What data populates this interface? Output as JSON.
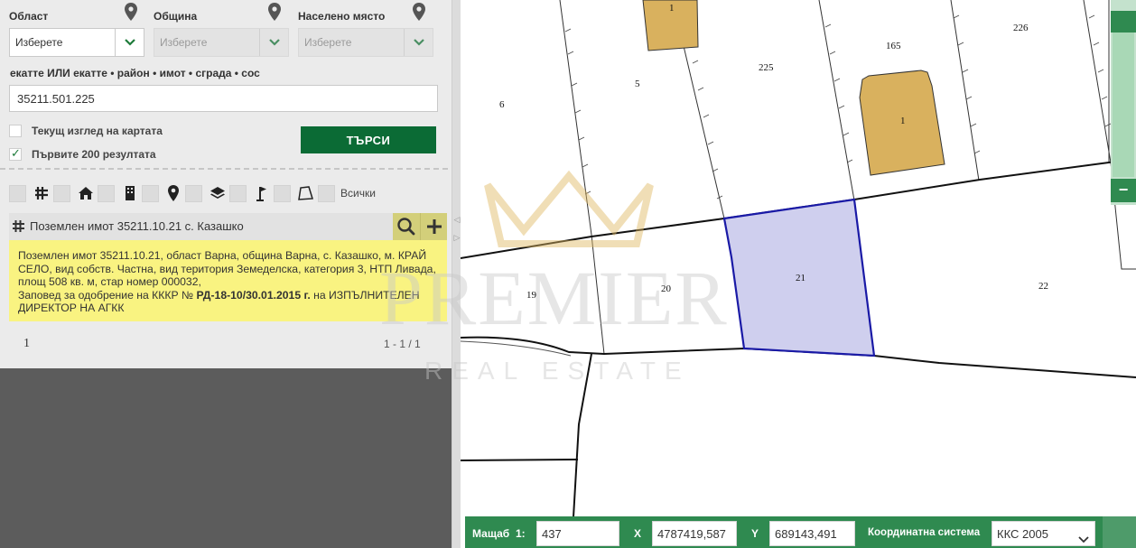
{
  "filters": {
    "region": {
      "label": "Област",
      "value": "Изберете"
    },
    "municipality": {
      "label": "Община",
      "value": "Изберете"
    },
    "settlement": {
      "label": "Населено място",
      "value": "Изберете"
    }
  },
  "search": {
    "label": "екатте ИЛИ екатте • район • имот • сграда • сос",
    "value": "35211.501.225",
    "current_view_label": "Текущ изглед на картата",
    "first200_label": "Първите 200 резултата",
    "button_label": "ТЪРСИ"
  },
  "toolbar": {
    "all_label": "Всички",
    "icons": [
      "parcel-grid-icon",
      "home-icon",
      "building-icon",
      "location-pin-icon",
      "layers-icon",
      "flag-icon",
      "polygon-icon"
    ]
  },
  "result": {
    "title": "Поземлен имот 35211.10.21 с. Казашко",
    "details_main": "Поземлен имот 35211.10.21, област Варна, община Варна, с. Казашко, м. КРАЙ СЕЛО, вид собств. Частна, вид територия Земеделска, категория 3, НТП Ливада, площ 508 кв. м, стар номер 000032,",
    "details_order_prefix": "Заповед за одобрение на КККР №",
    "details_order_number": "РД-18-10/30.01.2015 г.",
    "details_order_suffix": "на ИЗПЪЛНИТЕЛЕН ДИРЕКТОР НА АГКК",
    "page": "1",
    "range": "1 - 1 / 1"
  },
  "map": {
    "parcels": [
      "1",
      "5",
      "6",
      "225",
      "165",
      "226",
      "1",
      "21",
      "20",
      "19",
      "22"
    ],
    "selected_parcel": "21",
    "watermark": {
      "brand": "PREMIER",
      "tagline": "REAL ESTATE"
    },
    "zoom_minus": "−"
  },
  "statusbar": {
    "scale_label": "Мащаб",
    "scale_prefix": "1:",
    "scale_value": "437",
    "x_label": "X",
    "x_value": "4787419,587",
    "y_label": "Y",
    "y_value": "689143,491",
    "coord_label": "Координатна система",
    "coord_value": "ККС 2005"
  },
  "colors": {
    "green": "#0b6b35",
    "bar_green": "#2f8a50",
    "highlight": "#f9f381",
    "selected_fill": "#cfcfee",
    "selected_stroke": "#1a1aa6",
    "building": "#d9b15e"
  }
}
